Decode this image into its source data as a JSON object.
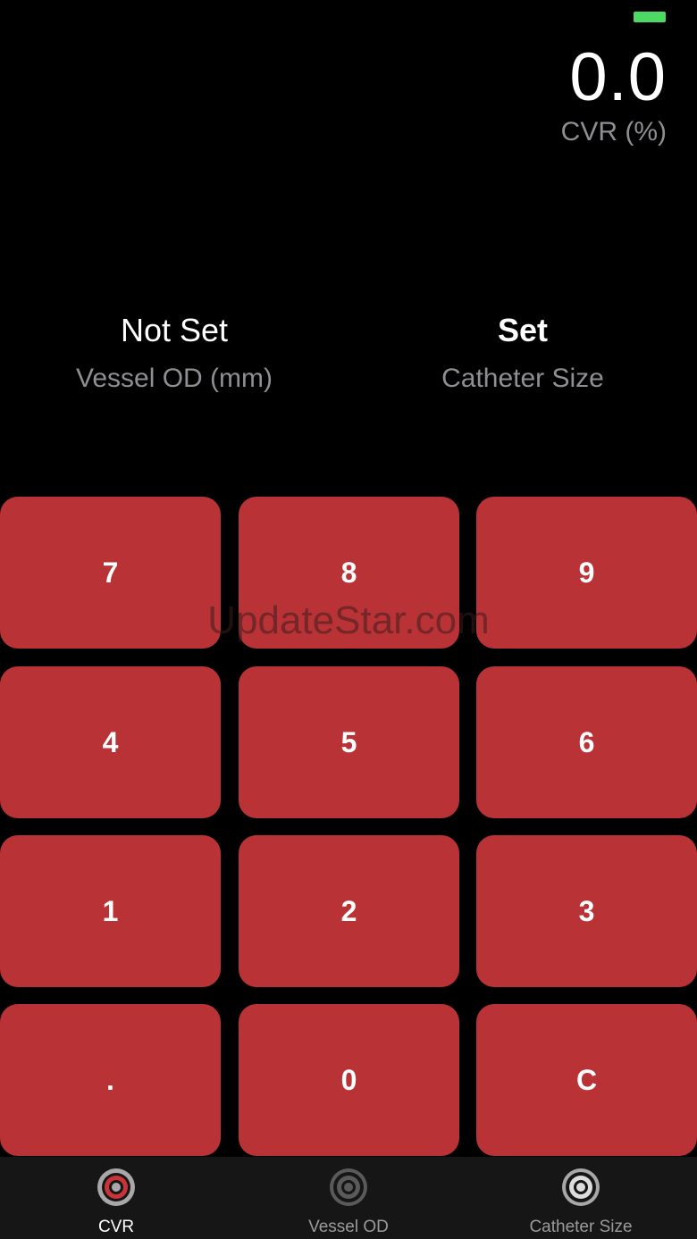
{
  "status": {
    "battery_color": "#4cd964"
  },
  "display": {
    "cvr_value": "0.0",
    "cvr_label": "CVR (%)"
  },
  "params": {
    "vessel": {
      "value": "Not Set",
      "label": "Vessel OD (mm)"
    },
    "catheter": {
      "value": "Set",
      "label": "Catheter Size"
    }
  },
  "keypad": {
    "keys": [
      "7",
      "8",
      "9",
      "4",
      "5",
      "6",
      "1",
      "2",
      "3",
      ".",
      "0",
      "C"
    ],
    "key_color": "#b83236"
  },
  "watermark": "UpdateStar.com",
  "tabbar": {
    "tabs": [
      {
        "label": "CVR",
        "icon": "cvr-target-icon",
        "active": true
      },
      {
        "label": "Vessel OD",
        "icon": "vessel-target-icon",
        "active": false
      },
      {
        "label": "Catheter Size",
        "icon": "catheter-target-icon",
        "active": false
      }
    ]
  }
}
